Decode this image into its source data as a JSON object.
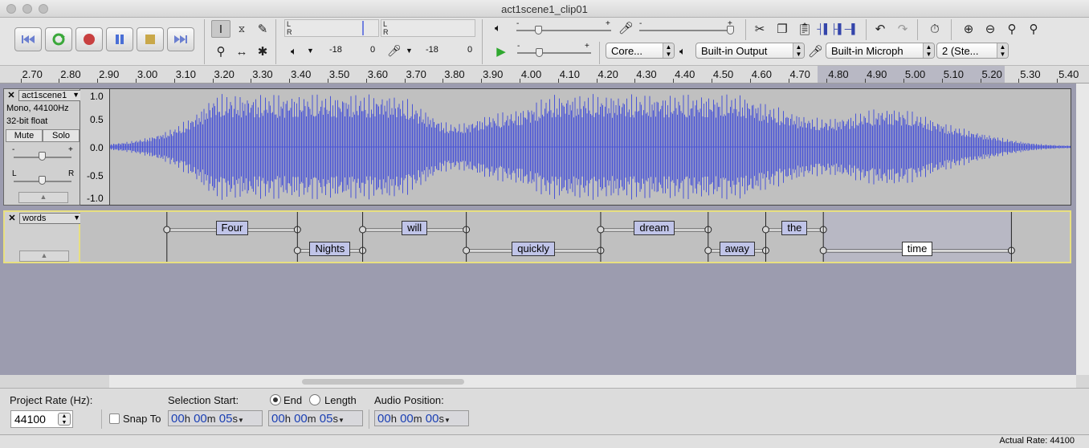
{
  "window": {
    "title": "act1scene1_clip01"
  },
  "transport": {
    "buttons": [
      "skip-to-start",
      "loop",
      "record",
      "pause",
      "stop",
      "skip-to-end"
    ]
  },
  "meters": {
    "record_db": [
      "-18",
      "0"
    ],
    "play_db": [
      "-18",
      "0"
    ],
    "channel_l": "L",
    "channel_r": "R"
  },
  "devices": {
    "host": "Core...",
    "output": "Built-in Output",
    "input": "Built-in Microph",
    "channels": "2 (Ste..."
  },
  "ruler": {
    "ticks": [
      "2.70",
      "2.80",
      "2.90",
      "3.00",
      "3.10",
      "3.20",
      "3.30",
      "3.40",
      "3.50",
      "3.60",
      "3.70",
      "3.80",
      "3.90",
      "4.00",
      "4.10",
      "4.20",
      "4.30",
      "4.40",
      "4.50",
      "4.60",
      "4.70",
      "4.80",
      "4.90",
      "5.00",
      "5.10",
      "5.20",
      "5.30",
      "5.40"
    ]
  },
  "audio_track": {
    "name": "act1scene1",
    "format": "Mono, 44100Hz",
    "bits": "32-bit float",
    "mute_label": "Mute",
    "solo_label": "Solo",
    "gain_minus": "-",
    "gain_plus": "+",
    "pan_l": "L",
    "pan_r": "R",
    "scale": [
      "1.0",
      "0.5",
      "0.0",
      "-0.5",
      "-1.0"
    ]
  },
  "label_track": {
    "name": "words",
    "labels": [
      {
        "text": "Four",
        "start": 3.05,
        "end": 3.39
      },
      {
        "text": "Nights",
        "start": 3.39,
        "end": 3.56
      },
      {
        "text": "will",
        "start": 3.56,
        "end": 3.83
      },
      {
        "text": "quickly",
        "start": 3.83,
        "end": 4.18
      },
      {
        "text": "dream",
        "start": 4.18,
        "end": 4.46
      },
      {
        "text": "away",
        "start": 4.46,
        "end": 4.61
      },
      {
        "text": "the",
        "start": 4.61,
        "end": 4.76
      },
      {
        "text": "time",
        "start": 4.76,
        "end": 5.25
      }
    ]
  },
  "selection_bar": {
    "project_rate_label": "Project Rate (Hz):",
    "project_rate": "44100",
    "snap_label": "Snap To",
    "selection_start_label": "Selection Start:",
    "end_label": "End",
    "length_label": "Length",
    "audio_position_label": "Audio Position:",
    "start_time": {
      "h": "00",
      "m": "00",
      "s": "05"
    },
    "end_time": {
      "h": "00",
      "m": "00",
      "s": "05"
    },
    "audio_pos": {
      "h": "00",
      "m": "00",
      "s": "00"
    },
    "unit_h": "h",
    "unit_m": "m",
    "unit_s": "s"
  },
  "status": {
    "actual_rate": "Actual Rate: 44100"
  },
  "colors": {
    "wave": "#4a55d6",
    "selection": "#b8b8c4",
    "label_fill": "#c0c4e8"
  }
}
